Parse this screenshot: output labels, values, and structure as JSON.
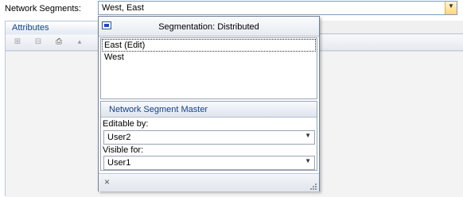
{
  "segments_field": {
    "label": "Network Segments:",
    "value": "West, East"
  },
  "attributes_tab": {
    "label": "Attributes"
  },
  "toolbar": {
    "icons": [
      "filter-icon",
      "columns-icon",
      "print-icon",
      "collapse-icon"
    ]
  },
  "popup": {
    "title": "Segmentation: Distributed",
    "segments": [
      {
        "label": "East (Edit)",
        "selected": true
      },
      {
        "label": "West",
        "selected": false
      }
    ],
    "master": {
      "header": "Network Segment Master",
      "editable_label": "Editable by:",
      "editable_value": "User2",
      "visible_label": "Visible for:",
      "visible_value": "User1"
    },
    "footer": {
      "close_glyph": "×"
    }
  },
  "colors": {
    "accent_text": "#15428b",
    "border": "#7f9db9"
  }
}
